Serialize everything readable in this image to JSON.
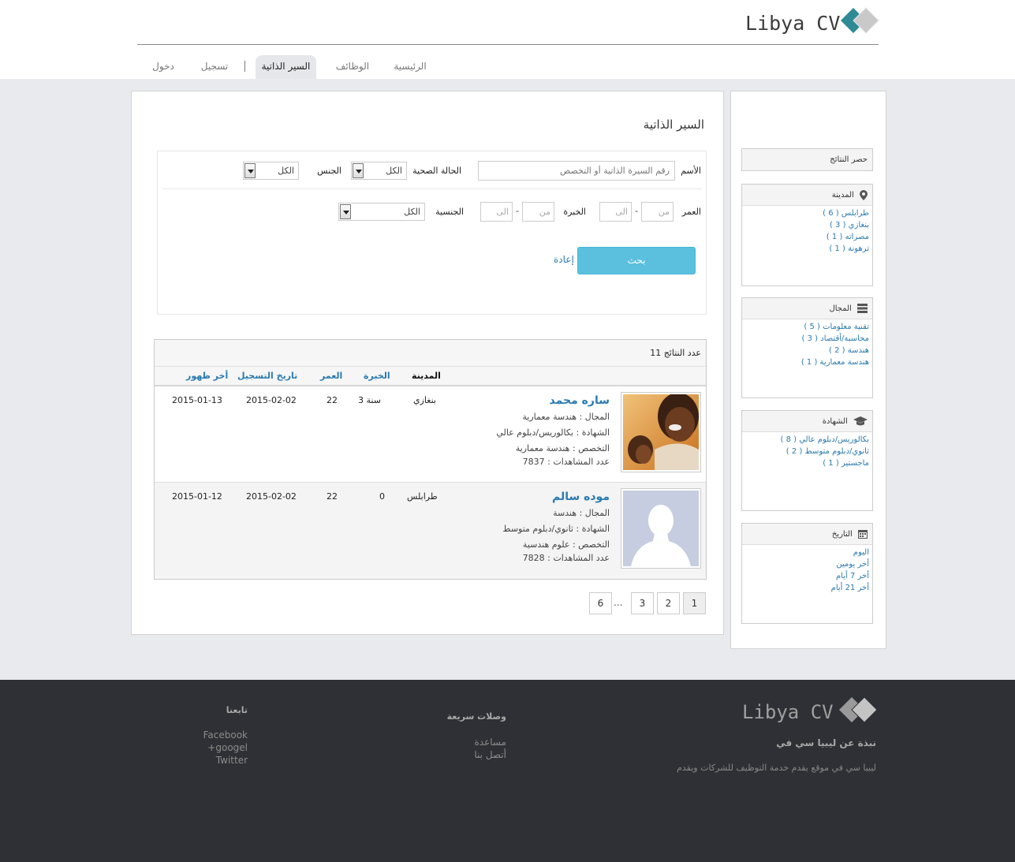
{
  "brand": {
    "name": "Libya CV"
  },
  "nav": {
    "home": "الرئيسية",
    "jobs": "الوظائف",
    "cvs": "السير الذاتية",
    "register": "تسجيل",
    "login": "دخول"
  },
  "page": {
    "title": "السير الذاتية"
  },
  "search": {
    "name_label": "الأسم",
    "name_placeholder": "رقم السيرة الذاتية أو التخصص",
    "health_label": "الحالة الصحية",
    "health_value": "الكل",
    "gender_label": "الجنس",
    "gender_value": "الكل",
    "age_label": "العمر",
    "experience_label": "الخبرة",
    "nationality_label": "الجنسية",
    "nationality_value": "الكل",
    "from_placeholder": "من",
    "to_placeholder": "الى",
    "dash": "-",
    "search_button": "بحث",
    "reset_link": "إعادة"
  },
  "results": {
    "count_label": "عدد النتائج 11",
    "headers": {
      "city": "المدينة",
      "experience": "الخبرة",
      "age": "العمر",
      "registered": "تاريخ التسجيل",
      "last_seen": "أخر ظهور"
    },
    "rows": [
      {
        "name": "ساره محمد",
        "field": "المجال : هندسة معمارية",
        "degree": "الشهادة : بكالوريس/دبلوم عالي",
        "specialty": "التخصص : هندسة معمارية",
        "views": "عدد المشاهدات : 7837",
        "city": "بنغازي",
        "experience": "3 سنة",
        "age": "22",
        "registered": "2015-02-02",
        "last_seen": "2015-01-13"
      },
      {
        "name": "موده سالم",
        "field": "المجال : هندسة",
        "degree": "الشهادة : ثانوي/دبلوم متوسط",
        "specialty": "التخصص : علوم هندسية",
        "views": "عدد المشاهدات : 7828",
        "city": "طرابلس",
        "experience": "0",
        "age": "22",
        "registered": "2015-02-02",
        "last_seen": "2015-01-12"
      }
    ]
  },
  "pagination": {
    "p1": "1",
    "p2": "2",
    "p3": "3",
    "ellipsis": "...",
    "p6": "6"
  },
  "sidebar": {
    "filter_title": "حصر النتائج",
    "city": {
      "title": "المدينة",
      "items": [
        "طرابلس ( 6 )",
        "بنغازي ( 3 )",
        "مصراته ( 1 )",
        "ترهونة ( 1 )"
      ]
    },
    "field": {
      "title": "المجال",
      "items": [
        "تقنية معلومات ( 5 )",
        "محاسبة/أقتصاد ( 3 )",
        "هندسة ( 2 )",
        "هندسة معمارية ( 1 )"
      ]
    },
    "degree": {
      "title": "الشهادة",
      "items": [
        "بكالوريس/دبلوم عالي ( 8 )",
        "ثانوي/دبلوم متوسط ( 2 )",
        "ماجستير ( 1 )"
      ]
    },
    "date": {
      "title": "التاريخ",
      "items": [
        "اليوم",
        "أخر يومين",
        "أخر 7 أيام",
        "أخر 21 أيام"
      ]
    }
  },
  "footer": {
    "about_title": "نبذة عن ليبيا سي في",
    "about_text": "ليبيا سي في موقع يقدم خدمة التوظيف للشركات ويقدم",
    "quick_links_title": "وصلات سريعة",
    "help": "مساعدة",
    "contact": "أتصل بنا",
    "follow_title": "تابعنا",
    "facebook": "Facebook",
    "google": "googel+",
    "twitter": "Twitter"
  },
  "colors": {
    "accent": "#2a7ab0",
    "button": "#5bc0de",
    "logo_teal": "#2e8a95",
    "footer_bg": "#2f3035"
  }
}
